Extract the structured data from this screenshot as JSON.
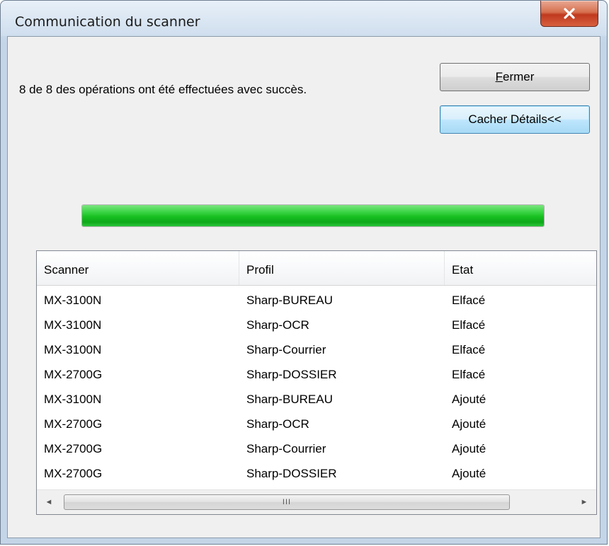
{
  "window": {
    "title": "Communication du scanner"
  },
  "status": {
    "message": "8 de 8 des opérations ont été effectuées avec succès."
  },
  "buttons": {
    "close_label_accel": "F",
    "close_label_rest": "ermer",
    "details_label": "Cacher Détails<<"
  },
  "progress": {
    "value_percent": 100,
    "color": "#18c020"
  },
  "list": {
    "columns": [
      "Scanner",
      "Profil",
      "Etat"
    ],
    "rows": [
      [
        "MX-3100N",
        "Sharp-BUREAU",
        "Elfacé"
      ],
      [
        "MX-3100N",
        "Sharp-OCR",
        "Elfacé"
      ],
      [
        "MX-3100N",
        "Sharp-Courrier",
        "Elfacé"
      ],
      [
        "MX-2700G",
        "Sharp-DOSSIER",
        "Elfacé"
      ],
      [
        "MX-3100N",
        "Sharp-BUREAU",
        "Ajouté"
      ],
      [
        "MX-2700G",
        "Sharp-OCR",
        "Ajouté"
      ],
      [
        "MX-2700G",
        "Sharp-Courrier",
        "Ajouté"
      ],
      [
        "MX-2700G",
        "Sharp-DOSSIER",
        "Ajouté"
      ]
    ]
  },
  "scrollbar": {
    "left_arrow": "◄",
    "right_arrow": "►",
    "grip": "III"
  },
  "icons": {
    "close": "close-icon"
  }
}
